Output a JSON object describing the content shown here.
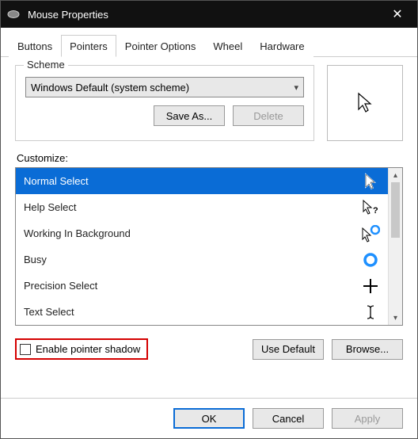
{
  "window": {
    "title": "Mouse Properties"
  },
  "tabs": {
    "items": [
      "Buttons",
      "Pointers",
      "Pointer Options",
      "Wheel",
      "Hardware"
    ],
    "active_index": 1
  },
  "scheme": {
    "group_label": "Scheme",
    "selected": "Windows Default (system scheme)",
    "save_as_label": "Save As...",
    "delete_label": "Delete"
  },
  "customize": {
    "label": "Customize:",
    "items": [
      {
        "label": "Normal Select",
        "icon": "cursor-arrow",
        "selected": true
      },
      {
        "label": "Help Select",
        "icon": "cursor-help",
        "selected": false
      },
      {
        "label": "Working In Background",
        "icon": "cursor-working",
        "selected": false
      },
      {
        "label": "Busy",
        "icon": "cursor-busy",
        "selected": false
      },
      {
        "label": "Precision Select",
        "icon": "cursor-precision",
        "selected": false
      },
      {
        "label": "Text Select",
        "icon": "cursor-text",
        "selected": false
      }
    ]
  },
  "options": {
    "enable_shadow_label": "Enable pointer shadow",
    "enable_shadow_checked": false,
    "use_default_label": "Use Default",
    "browse_label": "Browse..."
  },
  "footer": {
    "ok_label": "OK",
    "cancel_label": "Cancel",
    "apply_label": "Apply"
  }
}
